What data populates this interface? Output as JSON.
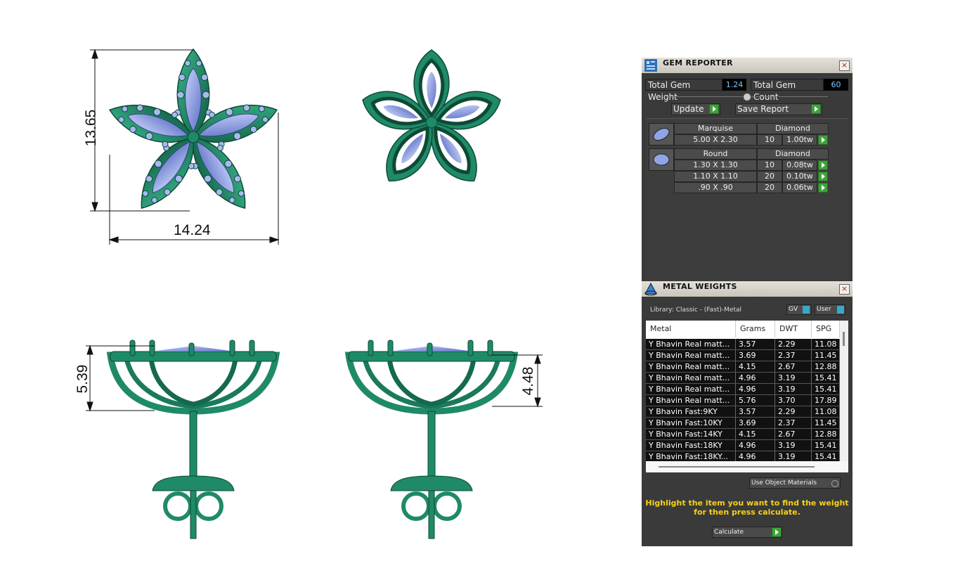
{
  "dimensions": {
    "top_height": "13.65",
    "top_width": "14.24",
    "side_left_height": "5.39",
    "side_right_height": "4.48"
  },
  "gem_reporter": {
    "title": "GEM REPORTER",
    "total_weight_label": "Total Gem Weight",
    "total_weight_value": "1.24",
    "total_count_label": "Total Gem Count",
    "total_count_value": "60",
    "update_label": "Update",
    "save_label": "Save Report",
    "groups": [
      {
        "cut": "Marquise",
        "material": "Diamond",
        "rows": [
          {
            "size": "5.00 X 2.30",
            "count": "10",
            "weight": "1.00tw"
          }
        ]
      },
      {
        "cut": "Round",
        "material": "Diamond",
        "rows": [
          {
            "size": "1.30 X 1.30",
            "count": "10",
            "weight": "0.08tw"
          },
          {
            "size": "1.10 X 1.10",
            "count": "20",
            "weight": "0.10tw"
          },
          {
            "size": ".90 X .90",
            "count": "20",
            "weight": "0.06tw"
          }
        ]
      }
    ]
  },
  "metal_weights": {
    "title": "METAL WEIGHTS",
    "library": "Library: Classic - (Fast)-Metal",
    "gv_label": "GV",
    "user_label": "User",
    "columns": [
      "Metal",
      "Grams",
      "DWT",
      "SPG"
    ],
    "rows": [
      [
        "Y Bhavin Real matt...",
        "3.57",
        "2.29",
        "11.08"
      ],
      [
        "Y Bhavin Real matt...",
        "3.69",
        "2.37",
        "11.45"
      ],
      [
        "Y Bhavin Real matt...",
        "4.15",
        "2.67",
        "12.88"
      ],
      [
        "Y Bhavin Real matt...",
        "4.96",
        "3.19",
        "15.41"
      ],
      [
        "Y Bhavin Real matt...",
        "4.96",
        "3.19",
        "15.41"
      ],
      [
        "Y Bhavin Real matt...",
        "5.76",
        "3.70",
        "17.89"
      ],
      [
        "Y Bhavin Fast:9KY",
        "3.57",
        "2.29",
        "11.08"
      ],
      [
        "Y Bhavin Fast:10KY",
        "3.69",
        "2.37",
        "11.45"
      ],
      [
        "Y Bhavin Fast:14KY",
        "4.15",
        "2.67",
        "12.88"
      ],
      [
        "Y Bhavin Fast:18KY",
        "4.96",
        "3.19",
        "15.41"
      ],
      [
        "Y Bhavin Fast:18KY...",
        "4.96",
        "3.19",
        "15.41"
      ]
    ],
    "use_object_materials": "Use Object Materials",
    "note_line1": "Highlight the item you want to find the weight",
    "note_line2": "for then press calculate.",
    "calculate_label": "Calculate"
  },
  "colors": {
    "metal": "#1f8a68",
    "metal_dark": "#0f5a42",
    "gem": "#8fa4e8",
    "panel_bg": "#3a3a3a"
  }
}
